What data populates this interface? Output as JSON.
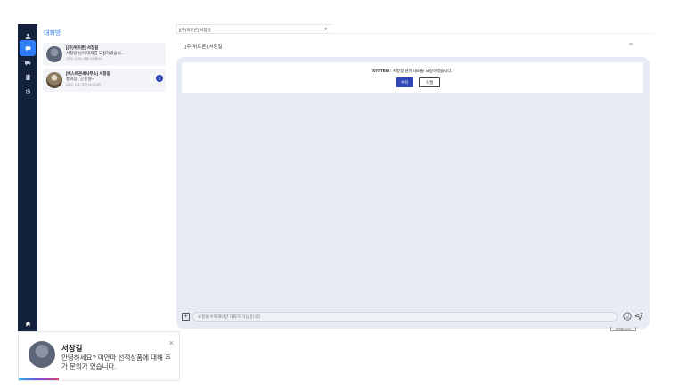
{
  "sidebar_rail": {
    "icons": [
      "user-icon",
      "chat-icon",
      "truck-icon",
      "building-icon",
      "gear-icon",
      "home-icon"
    ],
    "active": "chat-icon",
    "accent": "#2f7ef7",
    "background": "#14213d"
  },
  "chat_list": {
    "title": "대화방",
    "items": [
      {
        "name": "[(주)위트론] 서창길",
        "message": "서창길 님이 대화를 요청하였습니...",
        "time": "2022. 4. 20. 오후 10:58:21",
        "badge": ""
      },
      {
        "name": "[베스트관세사무소] 서창길",
        "message": "홍과장.. 곤뭉실~",
        "time": "2022. 4. 6. 오전 10:24:33",
        "badge": "3"
      }
    ]
  },
  "room_select": {
    "value": "[(주)위트론] 서창길"
  },
  "chat_header": {
    "title": "[(주)위트론] 서창길",
    "menu_icon": "hamburger-icon"
  },
  "system_message": {
    "prefix": "SYSTEM :",
    "text": "서창길 님이 대화를 요청하였습니다.",
    "accept_label": "수락",
    "reject_label": "거절",
    "accept_color": "#2e47b7"
  },
  "composer": {
    "placeholder": "요청을 수락해야만 대화가 가능합니다.",
    "counter": "0/1000 bytes"
  },
  "toast": {
    "name": "서창길",
    "message": "안녕하세요? 미안마 선적상품에 대해 추가 문의가 있습니다.",
    "close_label": "×"
  }
}
